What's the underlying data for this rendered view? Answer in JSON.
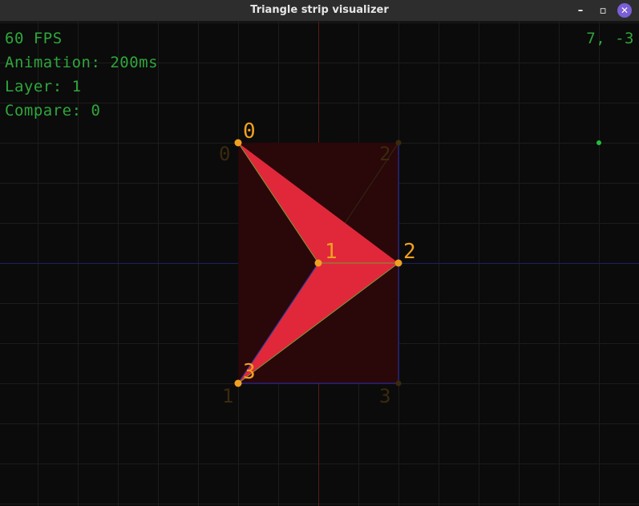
{
  "window": {
    "title": "Triangle strip visualizer",
    "minimize_glyph": "–",
    "maximize_glyph": "▫",
    "close_glyph": "✕"
  },
  "hud": {
    "fps": "60 FPS",
    "animation": "Animation: 200ms",
    "layer": "Layer: 1",
    "compare": "Compare: 0",
    "cursor_coords": "7, -3"
  },
  "colors": {
    "background": "#0b0b0b",
    "grid": "#1c1c1c",
    "axis_vertical": "#5a1a1a",
    "axis_horizontal": "#1e1e6e",
    "hud_text": "#2fa63b",
    "cursor_dot": "#22c03a",
    "triangle_fill": "#e0283a",
    "compare_fill": "#2a0709",
    "vertex": "#f0a020",
    "ghost_vertex": "#3a2a0e",
    "edge_green": "#7a9a3a",
    "edge_blue": "#2a2ab0"
  },
  "strip": {
    "vertices": [
      {
        "label": "0",
        "gx": -2,
        "gy": -3
      },
      {
        "label": "1",
        "gx": 0,
        "gy": 0
      },
      {
        "label": "2",
        "gx": 2,
        "gy": 0
      },
      {
        "label": "3",
        "gx": -2,
        "gy": 3
      }
    ]
  },
  "compare_strip": {
    "vertices": [
      {
        "label": "0",
        "gx": -2,
        "gy": -3
      },
      {
        "label": "1",
        "gx": -2,
        "gy": 3
      },
      {
        "label": "2",
        "gx": 2,
        "gy": -3
      },
      {
        "label": "3",
        "gx": 2,
        "gy": 3
      }
    ]
  },
  "cursor": {
    "gx": 7,
    "gy": -3
  }
}
